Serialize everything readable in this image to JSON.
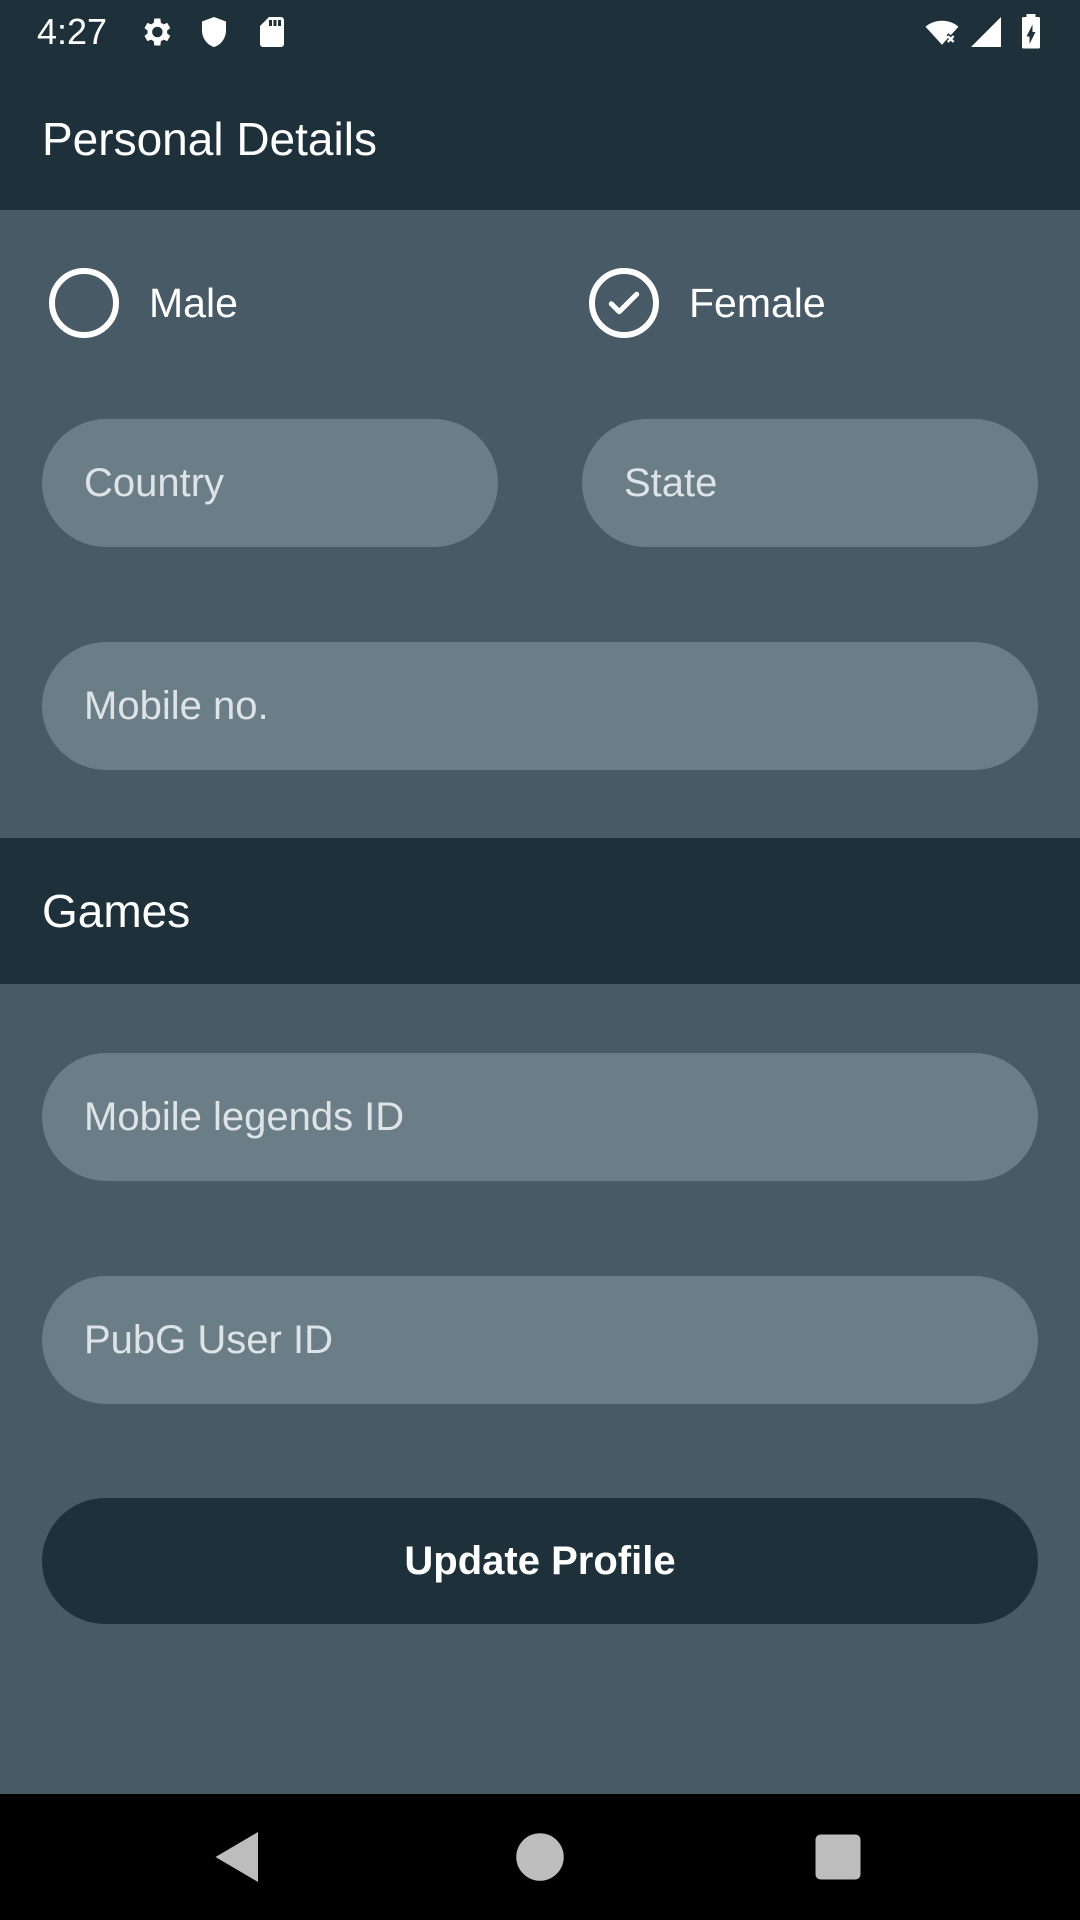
{
  "status_bar": {
    "time": "4:27",
    "icons": [
      "gear-icon",
      "shield-icon",
      "sd-card-icon",
      "wifi-off-icon",
      "signal-icon",
      "battery-charging-icon"
    ]
  },
  "header": {
    "title": "Personal Details"
  },
  "gender": {
    "options": [
      {
        "label": "Male",
        "selected": false
      },
      {
        "label": "Female",
        "selected": true
      }
    ]
  },
  "fields": {
    "country_placeholder": "Country",
    "state_placeholder": "State",
    "mobile_placeholder": "Mobile no.",
    "mobile_legends_placeholder": "Mobile legends ID",
    "pubg_placeholder": "PubG User ID"
  },
  "games_section": {
    "title": "Games"
  },
  "update_button": {
    "label": "Update Profile"
  },
  "nav": {
    "icons": [
      "back-icon",
      "home-icon",
      "recents-icon"
    ]
  },
  "colors": {
    "bar": "#1e313b",
    "background": "#475a66",
    "field": "#6b7d86",
    "text": "#ffffff"
  }
}
